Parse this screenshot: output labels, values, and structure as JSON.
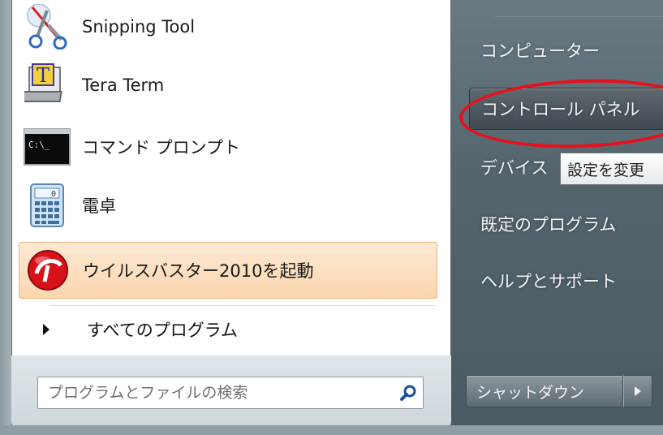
{
  "programs": [
    {
      "label": "Snipping Tool",
      "icon": "scissors-icon"
    },
    {
      "label": "Tera Term",
      "icon": "terminal-laptop-icon"
    },
    {
      "label": "コマンド プロンプト",
      "icon": "command-prompt-icon",
      "icon_text": "C:\\_"
    },
    {
      "label": "電卓",
      "icon": "calculator-icon"
    },
    {
      "label": "ウイルスバスター2010を起動",
      "icon": "virusbuster-icon",
      "highlighted": true
    }
  ],
  "all_programs_label": "すべてのプログラム",
  "search": {
    "placeholder": "プログラムとファイルの検索"
  },
  "right_items": [
    {
      "label": "コンピューター"
    },
    {
      "label": "コントロール パネル",
      "selected": true
    },
    {
      "label": "デバイス"
    },
    {
      "label": "既定のプログラム"
    },
    {
      "label": "ヘルプとサポート"
    }
  ],
  "tooltip": "設定を変更",
  "shutdown_label": "シャットダウン",
  "colors": {
    "highlight_orange": "#fbd6ae",
    "annotation_red": "#e8101c",
    "right_panel_bg": "#55656d"
  }
}
